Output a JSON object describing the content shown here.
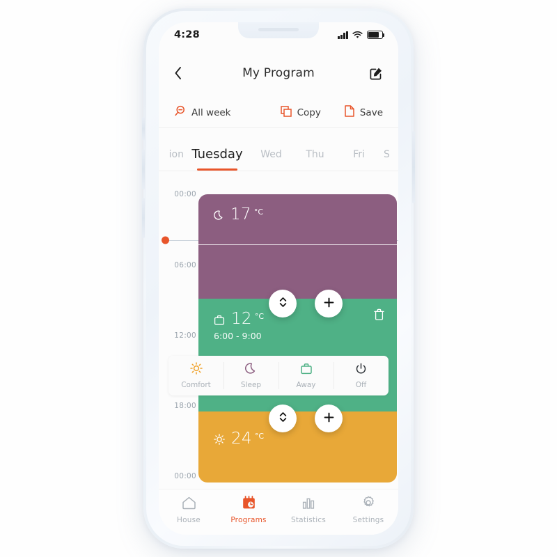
{
  "status_bar": {
    "time": "4:28",
    "signal_icon": "cellular-signal-icon",
    "wifi_icon": "wifi-icon",
    "battery_icon": "battery-icon"
  },
  "header": {
    "back_icon": "back-chevron-icon",
    "title": "My Program",
    "edit_icon": "edit-square-pencil-icon"
  },
  "toolbar": {
    "all_week_label": "All week",
    "all_week_icon": "magnifier-minus-icon",
    "copy_label": "Copy",
    "copy_icon": "copy-icon",
    "save_label": "Save",
    "save_icon": "save-file-icon",
    "accent_color": "#e8552a"
  },
  "day_tabs": {
    "tabs": [
      {
        "label": "ion",
        "active": false,
        "clipped": true
      },
      {
        "label": "Tuesday",
        "active": true,
        "clipped": false
      },
      {
        "label": "Wed",
        "active": false,
        "clipped": false
      },
      {
        "label": "Thu",
        "active": false,
        "clipped": false
      },
      {
        "label": "Fri",
        "active": false,
        "clipped": false
      },
      {
        "label": "S",
        "active": false,
        "clipped": true
      }
    ],
    "active_underline_color": "#e8552a"
  },
  "schedule": {
    "axis_labels": [
      "00:00",
      "06:00",
      "12:00",
      "18:00",
      "00:00"
    ],
    "now_marker_color": "#e8552a",
    "blocks": [
      {
        "mode": "Sleep",
        "icon": "moon-icon",
        "temperature": "17",
        "unit": "°C",
        "color": "#8c5e80",
        "time_range": ""
      },
      {
        "mode": "Away",
        "icon": "briefcase-icon",
        "temperature": "12",
        "unit": "°C",
        "color": "#4fb186",
        "time_range": "6:00 - 9:00",
        "delete_icon": "trash-icon"
      },
      {
        "mode": "Comfort",
        "icon": "sun-icon",
        "temperature": "24",
        "unit": "°C",
        "color": "#e8a838",
        "time_range": ""
      }
    ],
    "controls": {
      "resize_icon": "up-down-chevrons-icon",
      "add_icon": "plus-icon"
    }
  },
  "mode_selector": {
    "modes": [
      {
        "label": "Comfort",
        "icon": "sun-icon",
        "color": "#f0a22a"
      },
      {
        "label": "Sleep",
        "icon": "moon-icon",
        "color": "#8c5e80"
      },
      {
        "label": "Away",
        "icon": "briefcase-icon",
        "color": "#4fb186"
      },
      {
        "label": "Off",
        "icon": "power-icon",
        "color": "#2e3338"
      }
    ]
  },
  "bottom_nav": {
    "items": [
      {
        "label": "House",
        "icon": "home-icon",
        "active": false
      },
      {
        "label": "Programs",
        "icon": "calendar-clock-icon",
        "active": true
      },
      {
        "label": "Statistics",
        "icon": "bar-chart-icon",
        "active": false
      },
      {
        "label": "Settings",
        "icon": "gear-icon",
        "active": false
      }
    ],
    "active_color": "#e8552a",
    "inactive_color": "#aab1b8"
  }
}
